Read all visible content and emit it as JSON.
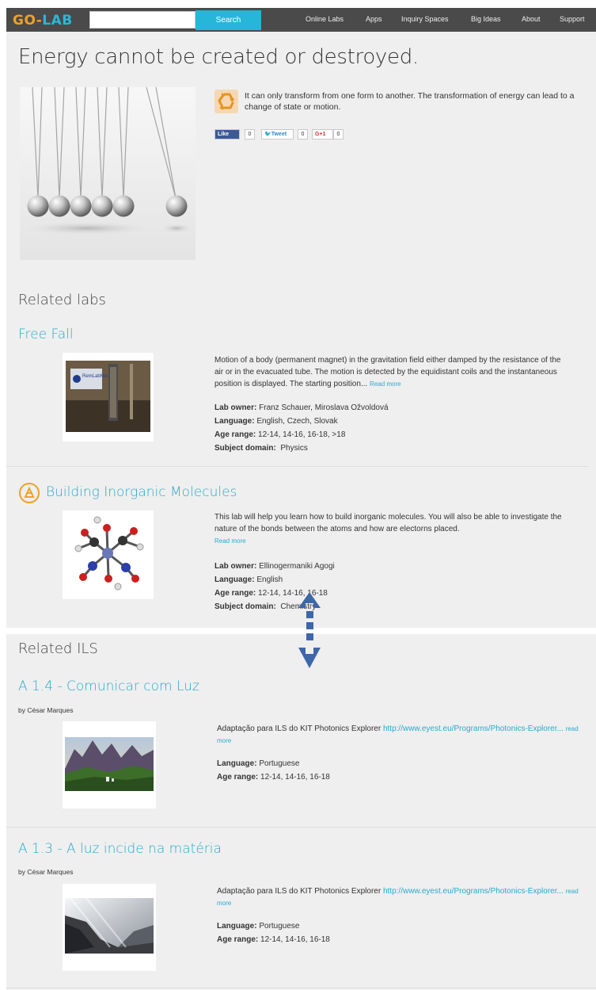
{
  "brand": {
    "go": "GO-",
    "lab": "LAB"
  },
  "search": {
    "placeholder": "",
    "button_label": "Search"
  },
  "nav": [
    "Online Labs",
    "Apps",
    "Inquiry Spaces",
    "Big Ideas",
    "About",
    "Support"
  ],
  "page_title": "Energy cannot be created or destroyed.",
  "intro_text": "It can only transform from one form to another. The transformation of energy can lead to a change of state or motion.",
  "social": {
    "like_label": "Like",
    "like_count": "0",
    "tweet_label": "Tweet",
    "tweet_count": "0",
    "gplus_label": "G+1",
    "gplus_count": "0"
  },
  "related_labs": {
    "heading": "Related labs",
    "items": [
      {
        "title": "Free Fall",
        "thumb_label": "RemLabNet",
        "description": "Motion of a body (permanent magnet) in the gravitation field either damped by the resistance of the air or in the evacuated tube. The motion is detected by the equidistant coils and the instantaneous position is displayed. The starting position...",
        "read_more": "Read more",
        "owner_label": "Lab owner:",
        "owner": "Franz Schauer, Miroslava Ožvoldová",
        "language_label": "Language:",
        "language": "English, Czech, Slovak",
        "age_label": "Age range:",
        "age": "12-14, 14-16, 16-18, >18",
        "subject_label": "Subject domain:",
        "subject": "Physics"
      },
      {
        "title": "Building Inorganic Molecules",
        "description": "This lab will help you learn how to build inorganic molecules. You will also be able to investigate the nature of the bonds between the atoms and how are electorns placed.",
        "read_more": "Read more",
        "owner_label": "Lab owner:",
        "owner": "Ellinogermaniki Agogi",
        "language_label": "Language:",
        "language": "English",
        "age_label": "Age range:",
        "age": "12-14, 14-16, 16-18",
        "subject_label": "Subject domain:",
        "subject": "Chemistry"
      }
    ]
  },
  "related_ils": {
    "heading": "Related ILS",
    "items": [
      {
        "title": "A 1.4 - Comunicar com Luz",
        "byline": "by César Marques",
        "description": "Adaptação para ILS do KIT Photonics Explorer",
        "link": "http://www.eyest.eu/Programs/Photonics-Explorer...",
        "read_more": "read more",
        "language_label": "Language:",
        "language": "Portuguese",
        "age_label": "Age range:",
        "age": "12-14, 14-16, 16-18"
      },
      {
        "title": "A 1.3 - A luz incide na matéria",
        "byline": "by César Marques",
        "description": "Adaptação para ILS do KIT Photonics Explorer",
        "link": "http://www.eyest.eu/Programs/Photonics-Explorer...",
        "read_more": "read more",
        "language_label": "Language:",
        "language": "Portuguese",
        "age_label": "Age range:",
        "age": "12-14, 14-16, 16-18"
      }
    ]
  },
  "colors": {
    "accent": "#28aacc",
    "nav_bg": "#4a4a4a",
    "search_button": "#26b6d7",
    "logo_go": "#f0a02a",
    "panel_bg": "#efefef",
    "connector_arrow": "#3d67a8"
  }
}
